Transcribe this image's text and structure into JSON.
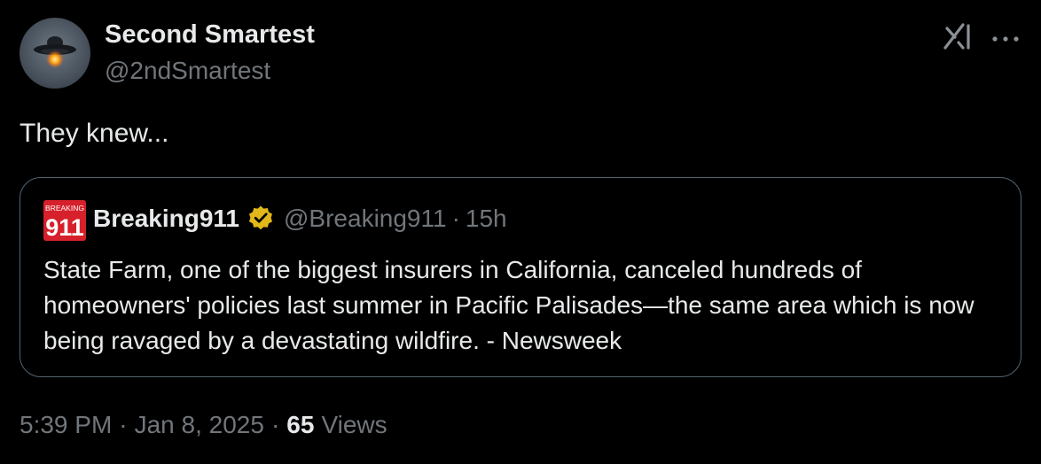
{
  "tweet": {
    "author": {
      "display_name": "Second Smartest",
      "handle": "@2ndSmartest",
      "avatar": "ufo-avatar"
    },
    "icons": {
      "grok": "grok-icon",
      "more": "more-options-icon"
    },
    "text": "They knew...",
    "quoted": {
      "logo_label_top": "BREAKING",
      "logo_label_main": "911",
      "display_name": "Breaking911",
      "verified": "gold-verified-badge",
      "handle": "@Breaking911",
      "separator": "·",
      "time": "15h",
      "text": "State Farm, one of the biggest insurers in California, canceled hundreds of homeowners' policies last summer in Pacific Palisades—the same area which is now being ravaged by a devastating wildfire. - Newsweek"
    },
    "meta": {
      "time": "5:39 PM",
      "separator": "·",
      "date": "Jan 8, 2025",
      "views_count": "65",
      "views_label": "Views"
    }
  },
  "colors": {
    "background": "#000000",
    "primary_text": "#e7e9ea",
    "secondary_text": "#71767b",
    "border": "#536471",
    "breaking_red": "#d6202b",
    "verified_gold": "#e2b719"
  }
}
